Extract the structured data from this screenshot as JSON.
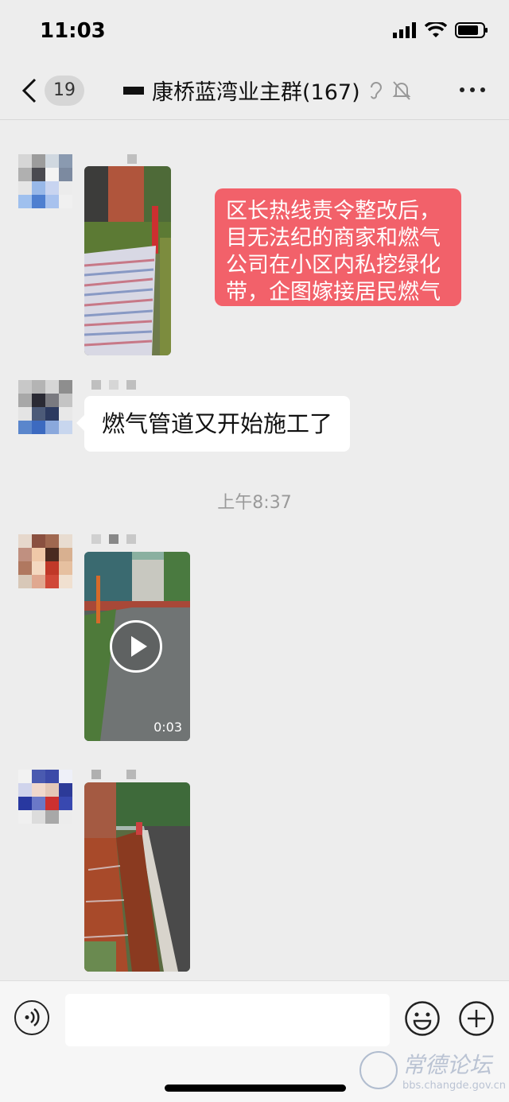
{
  "status": {
    "time": "11:03"
  },
  "header": {
    "unread_count": "19",
    "title": "康桥蓝湾业主群(167)"
  },
  "messages": [
    {
      "type": "image",
      "sender": "masked",
      "desc_colors": [
        "#5b6f3a",
        "#a34a35",
        "#c7c9d6"
      ]
    },
    {
      "type": "text",
      "from": "self",
      "text": "区长热线责令整改后，目无法纪的商家和燃气公司在小区内私挖绿化带，企图嫁接居民燃气",
      "lines": [
        "区长热线责令整改后，",
        "目无法纪的商家和燃气",
        "公司在小区内私挖绿化",
        "带，企图嫁接居民燃气"
      ],
      "color": "#f2616a"
    },
    {
      "type": "text",
      "from": "other",
      "text": "燃气管道又开始施工了"
    },
    {
      "type": "timestamp",
      "text": "上午8:37"
    },
    {
      "type": "video",
      "duration": "0:03"
    },
    {
      "type": "image"
    }
  ],
  "input": {
    "placeholder": ""
  },
  "icons": {
    "back": "chevron-left-icon",
    "ear": "ear-icon",
    "mute": "bell-off-icon",
    "more": "more-icon",
    "voice": "voice-icon",
    "emoji": "emoji-icon",
    "plus": "plus-icon"
  },
  "watermark": {
    "title": "常德论坛",
    "url": "bbs.changde.gov.cn"
  }
}
